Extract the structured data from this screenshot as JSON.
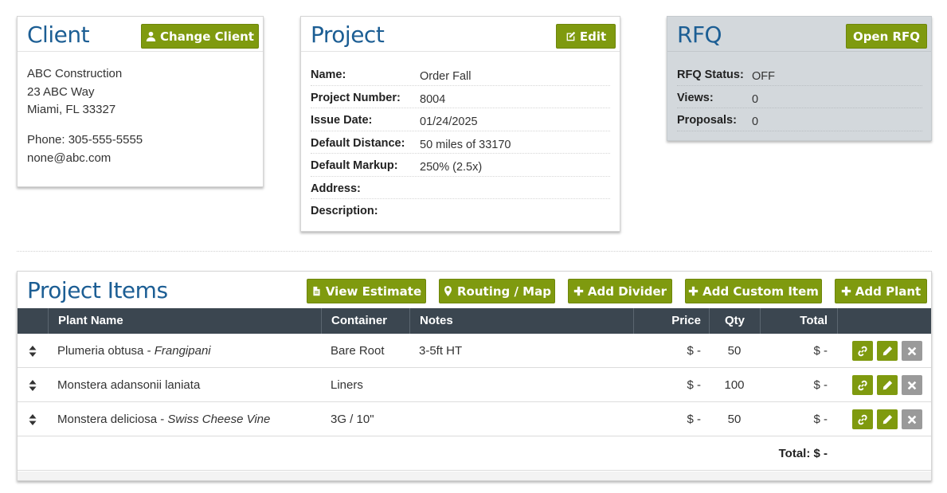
{
  "client": {
    "title": "Client",
    "change_label": "Change Client",
    "company": "ABC Construction",
    "street": "23 ABC Way",
    "city": "Miami, FL 33327",
    "phone": "Phone: 305-555-5555",
    "email": "none@abc.com"
  },
  "project": {
    "title": "Project",
    "edit_label": "Edit",
    "fields": [
      {
        "label": "Name:",
        "value": "Order Fall"
      },
      {
        "label": "Project Number:",
        "value": "8004"
      },
      {
        "label": "Issue Date:",
        "value": "01/24/2025"
      },
      {
        "label": "Default Distance:",
        "value": "50 miles of 33170"
      },
      {
        "label": "Default Markup:",
        "value": "250% (2.5x)"
      },
      {
        "label": "Address:",
        "value": ""
      },
      {
        "label": "Description:",
        "value": ""
      }
    ]
  },
  "rfq": {
    "title": "RFQ",
    "open_label": "Open RFQ",
    "fields": [
      {
        "label": "RFQ Status:",
        "value": "OFF"
      },
      {
        "label": "Views:",
        "value": "0"
      },
      {
        "label": "Proposals:",
        "value": "0"
      }
    ]
  },
  "items": {
    "title": "Project Items",
    "buttons": {
      "view_estimate": "View Estimate",
      "routing_map": "Routing / Map",
      "add_divider": "Add Divider",
      "add_custom": "Add Custom Item",
      "add_plant": "Add Plant"
    },
    "columns": {
      "plant_name": "Plant Name",
      "container": "Container",
      "notes": "Notes",
      "price": "Price",
      "qty": "Qty",
      "total": "Total"
    },
    "rows": [
      {
        "name": "Plumeria obtusa",
        "sep": " - ",
        "common": "Frangipani",
        "container": "Bare Root",
        "notes": "3-5ft HT",
        "price": "$ -",
        "qty": "50",
        "total": "$ -"
      },
      {
        "name": "Monstera adansonii laniata",
        "sep": "",
        "common": "",
        "container": "Liners",
        "notes": "",
        "price": "$ -",
        "qty": "100",
        "total": "$ -"
      },
      {
        "name": "Monstera deliciosa",
        "sep": " - ",
        "common": "Swiss Cheese Vine",
        "container": "3G / 10\"",
        "notes": "",
        "price": "$ -",
        "qty": "50",
        "total": "$ -"
      }
    ],
    "grand_total": "Total: $ -"
  },
  "colors": {
    "accent_green": "#7f9a0f",
    "title_blue": "#1c5e94",
    "header_dark": "#3b4650",
    "rfq_bg": "#d3d8dc"
  }
}
